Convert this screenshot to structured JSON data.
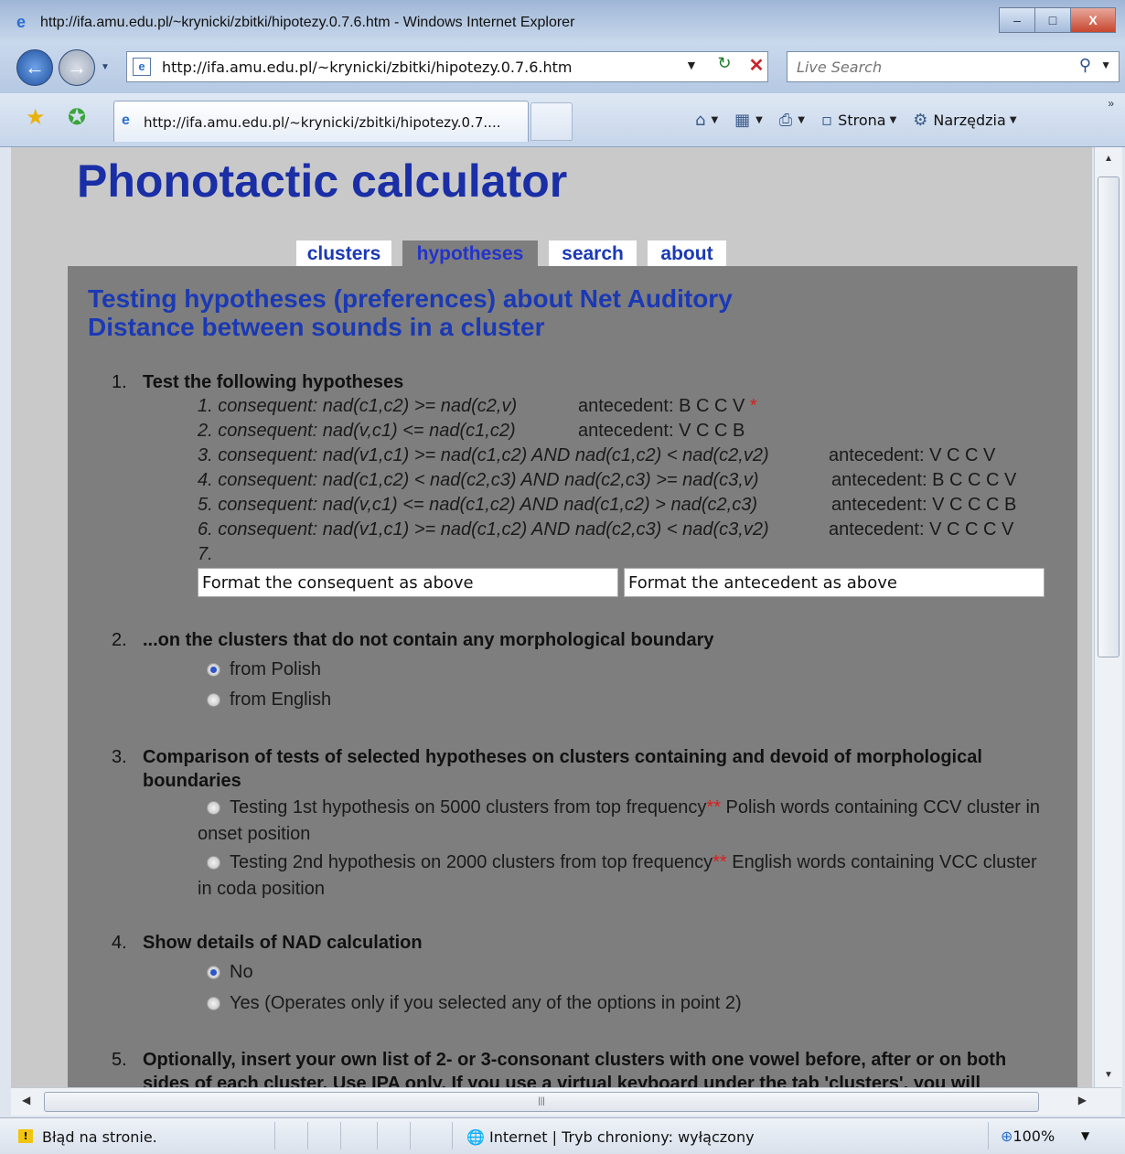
{
  "window": {
    "title": "http://ifa.amu.edu.pl/~krynicki/zbitki/hipotezy.0.7.6.htm - Windows Internet Explorer",
    "minimize": "–",
    "maximize": "□",
    "close": "X"
  },
  "address_bar": {
    "url": "http://ifa.amu.edu.pl/~krynicki/zbitki/hipotezy.0.7.6.htm"
  },
  "search": {
    "placeholder": "Live Search"
  },
  "tab": {
    "title": "http://ifa.amu.edu.pl/~krynicki/zbitki/hipotezy.0.7...."
  },
  "command_bar": {
    "page_label": "Strona",
    "tools_label": "Narzędzia"
  },
  "page": {
    "title": "Phonotactic calculator",
    "tabs": [
      "clusters",
      "hypotheses",
      "search",
      "about"
    ],
    "active_tab": "hypotheses",
    "heading_line1": "Testing hypotheses (preferences) about Net Auditory",
    "heading_line2": "Distance between sounds in a cluster",
    "sections": [
      {
        "number": "1.",
        "heading": "Test the following hypotheses"
      },
      {
        "number": "2.",
        "heading": "...on the clusters that do not contain any morphological boundary"
      },
      {
        "number": "3.",
        "heading_line1": "Comparison of tests of selected hypotheses on clusters containing and devoid of morphological",
        "heading_line2": "boundaries"
      },
      {
        "number": "4.",
        "heading": "Show details of NAD calculation"
      },
      {
        "number": "5.",
        "heading_line1": "Optionally, insert your own list of 2- or 3-consonant clusters with one vowel before, after or on both",
        "heading_line2": "sides of each cluster. Use IPA only. If you use a virtual keyboard under the tab 'clusters', you will"
      }
    ],
    "hypotheses": [
      {
        "consequent": "1. consequent: nad(c1,c2) >= nad(c2,v)",
        "antecedent": "antecedent: B C C V",
        "mark": "*"
      },
      {
        "consequent": "2. consequent: nad(v,c1) <= nad(c1,c2)",
        "antecedent": "antecedent: V C C B"
      },
      {
        "consequent": "3. consequent: nad(v1,c1) >= nad(c1,c2) AND nad(c1,c2) < nad(c2,v2)",
        "antecedent": "antecedent: V C C V"
      },
      {
        "consequent": "4. consequent: nad(c1,c2) < nad(c2,c3) AND nad(c2,c3) >= nad(c3,v)",
        "antecedent": "antecedent: B C C C V"
      },
      {
        "consequent": "5. consequent: nad(v,c1) <= nad(c1,c2) AND nad(c1,c2) > nad(c2,c3)",
        "antecedent": "antecedent: V C C C B"
      },
      {
        "consequent": "6. consequent: nad(v1,c1) >= nad(c1,c2) AND nad(c2,c3) < nad(c3,v2)",
        "antecedent": "antecedent: V C C C V"
      }
    ],
    "hypothesis_7_label": "7.",
    "consequent_field_value": "Format the consequent as above",
    "antecedent_field_value": "Format the antecedent as above",
    "boundary_options": [
      {
        "label": "from Polish",
        "selected": true
      },
      {
        "label": "from English",
        "selected": false
      }
    ],
    "comparison_options": [
      {
        "before": "Testing 1st hypothesis on 5000 clusters from top frequency",
        "mark": "**",
        "after": " Polish words containing CCV cluster in",
        "line2": "onset position",
        "selected": false
      },
      {
        "before": "Testing 2nd hypothesis on 2000 clusters from top frequency",
        "mark": "**",
        "after": " English words containing VCC cluster",
        "line2": "in coda position",
        "selected": false
      }
    ],
    "details_options": [
      {
        "label": "No",
        "selected": true
      },
      {
        "label": "Yes (Operates only if you selected any of the options in point 2)",
        "selected": false
      }
    ]
  },
  "status_bar": {
    "message": "Błąd na stronie.",
    "zone": "Internet | Tryb chroniony: wyłączony",
    "zoom": "100%"
  },
  "colors": {
    "page_title": "#1a2ea6",
    "tab_text": "#1b39b4",
    "panel_background": "#7e7e7e",
    "page_background": "#c9c9c9",
    "asterisk": "#e01b1b",
    "radio_selected": "#2b55c9"
  },
  "icons": [
    "ie-logo-icon",
    "back-arrow-icon",
    "forward-arrow-icon",
    "page-icon",
    "refresh-icon",
    "stop-icon",
    "search-magnifier-icon",
    "favorites-star-icon",
    "add-favorites-icon",
    "home-icon",
    "feeds-icon",
    "print-icon",
    "page-menu-icon",
    "tools-gear-icon",
    "warning-icon",
    "globe-icon",
    "zoom-icon"
  ]
}
